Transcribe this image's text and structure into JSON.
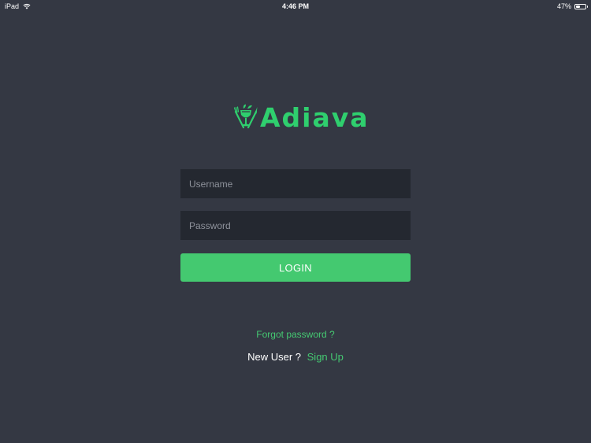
{
  "status_bar": {
    "device": "iPad",
    "time": "4:46 PM",
    "battery_percent": "47%",
    "battery_level": 0.47,
    "wifi_icon": "wifi-icon",
    "battery_icon": "battery-icon"
  },
  "brand": {
    "name": "Adiava",
    "icon": "wine-glass-cutlery-icon",
    "color": "#2fcf6e"
  },
  "login_form": {
    "username_placeholder": "Username",
    "username_value": "",
    "password_placeholder": "Password",
    "password_value": "",
    "login_label": "LOGIN",
    "button_color": "#44c970"
  },
  "links": {
    "forgot_password": "Forgot password ?",
    "new_user": "New User ?",
    "sign_up": "Sign Up"
  },
  "colors": {
    "background": "#343843",
    "field_background": "#242830",
    "link": "#45c972"
  }
}
